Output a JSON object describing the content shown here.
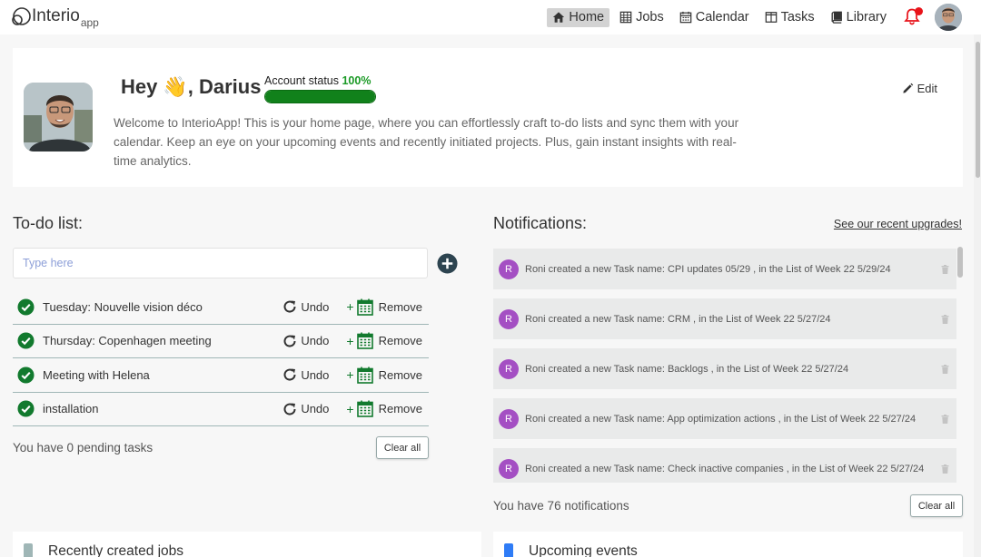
{
  "nav": {
    "logo_main": "Interio",
    "logo_sub": "app",
    "items": [
      {
        "label": "Home",
        "icon": "home-icon",
        "active": true
      },
      {
        "label": "Jobs",
        "icon": "table-icon",
        "active": false
      },
      {
        "label": "Calendar",
        "icon": "calendar-icon",
        "active": false
      },
      {
        "label": "Tasks",
        "icon": "columns-icon",
        "active": false
      },
      {
        "label": "Library",
        "icon": "book-icon",
        "active": false
      }
    ],
    "bell_icon": "bell-icon",
    "bell_color": "#e8131a"
  },
  "welcome": {
    "greeting": "Hey",
    "wave": "👋",
    "name": ", Darius",
    "status_label": "Account status",
    "status_value": "100%",
    "status_fraction": 1.0,
    "status_color": "#11811b",
    "edit_label": "Edit",
    "intro": "Welcome to InterioApp! This is your home page, where you can effortlessly craft to-do lists and sync them with your calendar. Keep an eye on your upcoming events and recently initiated projects. Plus, gain instant insights with real-time analytics."
  },
  "todo": {
    "title": "To-do list:",
    "input_placeholder": "Type here",
    "items": [
      {
        "text": "Tuesday: Nouvelle vision déco"
      },
      {
        "text": "Thursday: Copenhagen meeting"
      },
      {
        "text": "Meeting with Helena"
      },
      {
        "text": "installation"
      }
    ],
    "undo_label": "Undo",
    "remove_plus": "+",
    "remove_label": "Remove",
    "pending": "You have 0 pending tasks",
    "clear_label": "Clear all",
    "check_color": "#127a2e"
  },
  "notifications": {
    "title": "Notifications:",
    "link": "See our recent upgrades!",
    "items": [
      {
        "avatar": "R",
        "text": "Roni created a new Task name: CPI updates 05/29 , in the List of Week 22 5/29/24"
      },
      {
        "avatar": "R",
        "text": "Roni created a new Task name: CRM , in the List of Week 22 5/27/24"
      },
      {
        "avatar": "R",
        "text": "Roni created a new Task name: Backlogs , in the List of Week 22 5/27/24"
      },
      {
        "avatar": "R",
        "text": "Roni created a new Task name: App optimization actions , in the List of Week 22 5/27/24"
      },
      {
        "avatar": "R",
        "text": "Roni created a new Task name: Check inactive companies , in the List of Week 22 5/27/24"
      }
    ],
    "count": "You have 76 notifications",
    "clear_label": "Clear all",
    "avatar_color": "#a44fc3"
  },
  "cards": {
    "jobs_title": "Recently created jobs",
    "jobs_color": "#9fb6b6",
    "events_title": "Upcoming events",
    "events_color": "#2f7cf6"
  }
}
